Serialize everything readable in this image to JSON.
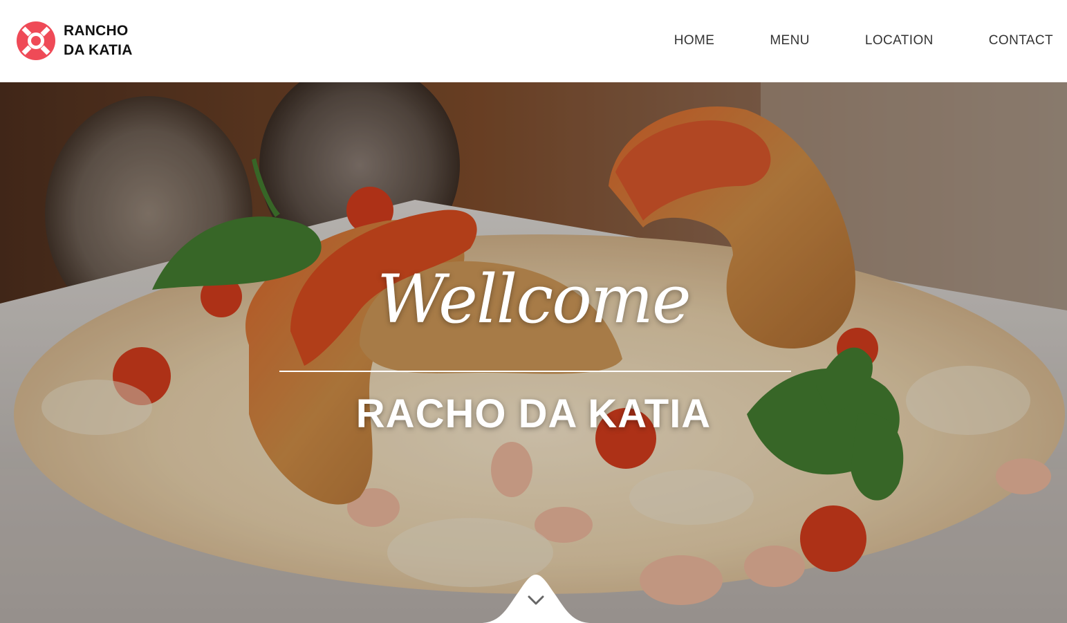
{
  "brand": {
    "line1": "RANCHO",
    "line2": "DA KATIA",
    "icon": "lifebuoy-icon",
    "accent_color": "#ef4a57"
  },
  "nav": {
    "items": [
      {
        "label": "HOME"
      },
      {
        "label": "MENU"
      },
      {
        "label": "LOCATION"
      },
      {
        "label": "CONTACT"
      }
    ]
  },
  "hero": {
    "welcome": "Wellcome",
    "title": "RACHO DA KATIA",
    "scroll_icon": "chevron-down-icon"
  }
}
